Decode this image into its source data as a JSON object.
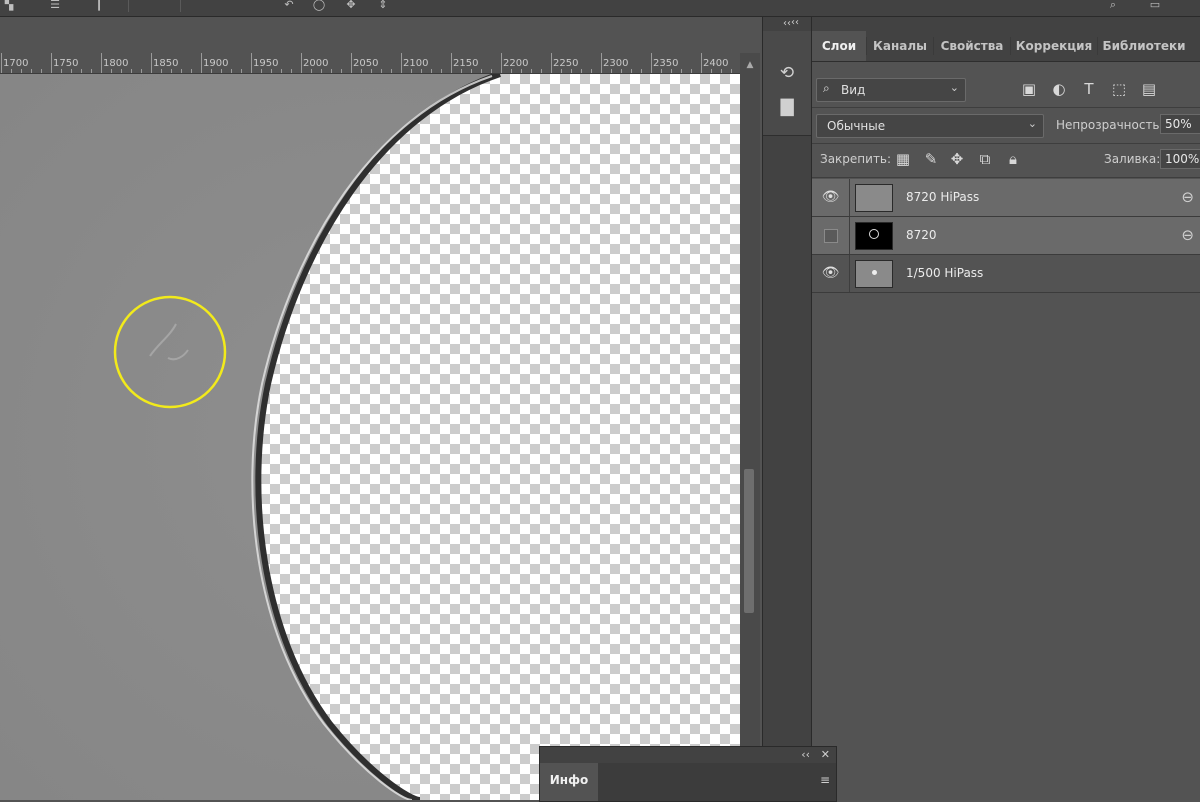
{
  "ruler": {
    "labels": [
      "1700",
      "1750",
      "1800",
      "1850",
      "1900",
      "1950",
      "2000",
      "2050",
      "2100",
      "2150",
      "2200",
      "2250",
      "2300",
      "2350",
      "2400"
    ]
  },
  "dock": {
    "collapse_glyph": "‹‹",
    "icons": [
      "history-icon",
      "comment-icon"
    ]
  },
  "layers_panel": {
    "collapse_glyph": "‹‹",
    "tabs": [
      {
        "label": "Слои",
        "active": true
      },
      {
        "label": "Каналы",
        "active": false
      },
      {
        "label": "Свойства",
        "active": false
      },
      {
        "label": "Коррекция",
        "active": false
      },
      {
        "label": "Библиотеки",
        "active": false
      }
    ],
    "filter": {
      "value": "Вид"
    },
    "blend_mode": "Обычные",
    "opacity_label": "Непрозрачность:",
    "opacity_value": "50%",
    "lock_label": "Закрепить:",
    "fill_label": "Заливка:",
    "fill_value": "100%",
    "layers": [
      {
        "name": "8720 HiPass",
        "visible": true,
        "selected": true,
        "linked": true
      },
      {
        "name": "8720",
        "visible": false,
        "selected": true,
        "linked": true
      },
      {
        "name": "1/500 HiPass",
        "visible": true,
        "selected": false,
        "linked": false
      }
    ]
  },
  "info_panel": {
    "title": "Инфо",
    "collapse_glyph": "‹‹",
    "close_glyph": "✕",
    "menu_glyph": "≡"
  },
  "colors": {
    "annotation_circle": "#f2ea1b",
    "panel_bg": "#535353",
    "tab_bar_bg": "#424242"
  }
}
